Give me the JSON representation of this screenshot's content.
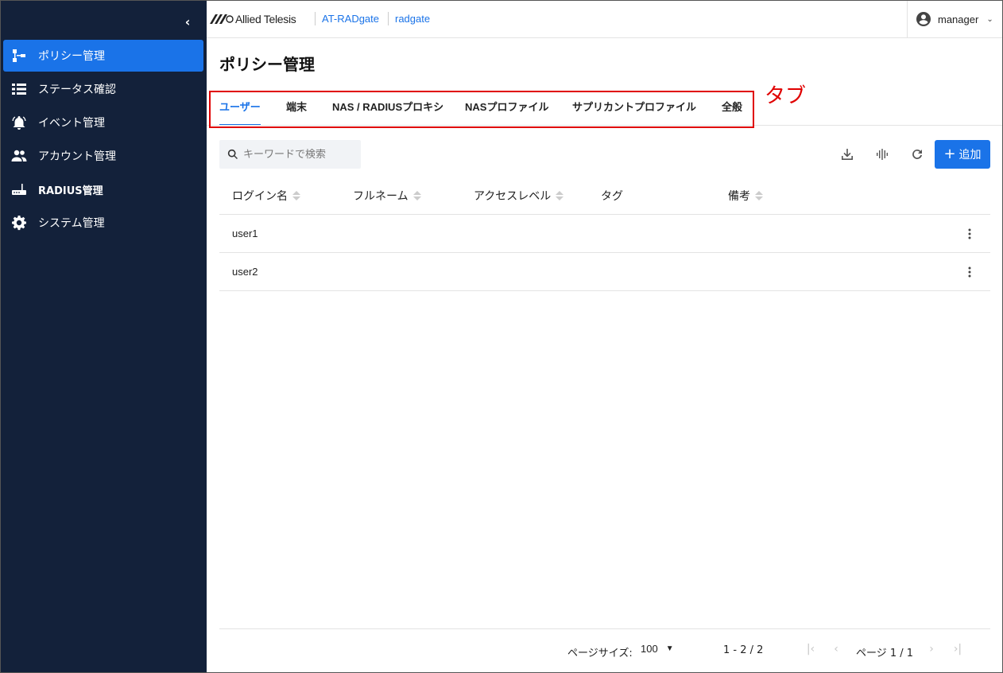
{
  "colors": {
    "sidebar_bg": "#13213a",
    "accent": "#1a73e8",
    "annotation": "#e00000"
  },
  "sidebar": {
    "collapse_icon": "chevron-left-icon",
    "items": [
      {
        "label": "ポリシー管理",
        "icon": "policy-tree-icon",
        "active": true
      },
      {
        "label": "ステータス確認",
        "icon": "list-icon"
      },
      {
        "label": "イベント管理",
        "icon": "bell-icon"
      },
      {
        "label": "アカウント管理",
        "icon": "people-icon"
      },
      {
        "label": "RADIUS管理",
        "icon": "router-icon"
      },
      {
        "label": "システム管理",
        "icon": "gear-icon"
      }
    ]
  },
  "header": {
    "logo_text": "Allied Telesis",
    "breadcrumb": [
      "AT-RADgate",
      "radgate"
    ],
    "user": "manager"
  },
  "page": {
    "title": "ポリシー管理",
    "annotation_label": "タブ",
    "tabs": [
      {
        "label": "ユーザー",
        "active": true
      },
      {
        "label": "端末"
      },
      {
        "label": "NAS / RADIUSプロキシ"
      },
      {
        "label": "NASプロファイル"
      },
      {
        "label": "サプリカントプロファイル"
      },
      {
        "label": "全般"
      }
    ],
    "search_placeholder": "キーワードで検索",
    "toolbar": {
      "download_icon": "download-icon",
      "waveform_icon": "waveform-icon",
      "refresh_icon": "refresh-icon",
      "add_label": "追加"
    },
    "table": {
      "columns": [
        "ログイン名",
        "フルネーム",
        "アクセスレベル",
        "タグ",
        "備考"
      ],
      "rows": [
        {
          "login": "user1"
        },
        {
          "login": "user2"
        }
      ]
    },
    "pagination": {
      "page_size_label": "ページサイズ:",
      "page_size": "100",
      "range": "1 - 2 / 2",
      "page_label": "ページ 1 / 1"
    }
  }
}
